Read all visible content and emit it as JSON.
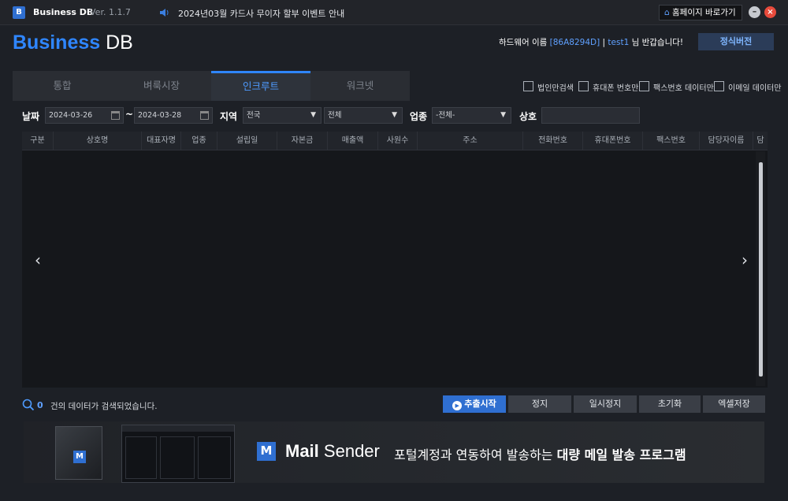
{
  "window": {
    "app_icon_letter": "B",
    "app_name": "Business DB",
    "version": "Ver. 1.1.7",
    "notice": "2024년03월 카드사 무이자 할부 이벤트 안내",
    "home_label": "홈페이지 바로가기",
    "minimize_glyph": "–",
    "close_glyph": "×"
  },
  "header": {
    "brand_main": "Business",
    "brand_db": " DB",
    "hw_prefix": "하드웨어 이름 ",
    "hw_id": "[86A8294D]",
    "hw_sep": " | ",
    "user": "test1",
    "hw_suffix": " 님 반갑습니다!",
    "official_label": "정식버전"
  },
  "tabs": [
    {
      "label": "통합",
      "active": false
    },
    {
      "label": "벼룩시장",
      "active": false
    },
    {
      "label": "인크루트",
      "active": true
    },
    {
      "label": "워크넷",
      "active": false
    }
  ],
  "options": [
    {
      "label": "법인만검색",
      "checked": false
    },
    {
      "label": "휴대폰 번호만",
      "checked": false
    },
    {
      "label": "팩스번호 데이터만",
      "checked": false
    },
    {
      "label": "이메일 데이터만",
      "checked": false
    }
  ],
  "search": {
    "date_label": "날짜",
    "date_from": "2024-03-26",
    "date_sep": "~",
    "date_to": "2024-03-28",
    "region_label": "지역",
    "region_value": "전국",
    "subregion_value": "전체",
    "industry_label": "업종",
    "industry_value": "-전체-",
    "company_label": "상호",
    "company_value": ""
  },
  "table": {
    "columns": [
      "구분",
      "상호명",
      "대표자명",
      "업종",
      "설립일",
      "자본금",
      "매출액",
      "사원수",
      "주소",
      "전화번호",
      "휴대폰번호",
      "팩스번호",
      "담당자이름",
      "담"
    ],
    "rows": []
  },
  "nav": {
    "prev": "‹",
    "next": "›"
  },
  "status": {
    "count": "0",
    "text": "건의 데이터가 검색되었습니다."
  },
  "actions": {
    "start": "추출시작",
    "stop": "정지",
    "pause": "일시정지",
    "reset": "초기화",
    "excel": "엑셀저장"
  },
  "banner": {
    "logo_letter": "M",
    "name_bold": "Mail",
    "name_rest": "Sender",
    "slogan_normal": "포털계정과 연동하여 발송하는 ",
    "slogan_bold": "대량 메일 발송 프로그램"
  },
  "colors": {
    "accent": "#2f86ff",
    "button_primary": "#2f6fd1",
    "close": "#e84b3c"
  }
}
